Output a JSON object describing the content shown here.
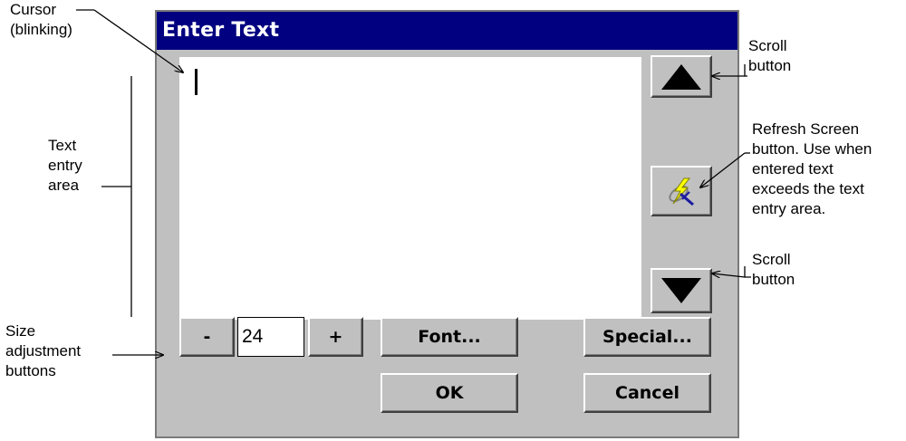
{
  "dialog": {
    "title": "Enter Text",
    "size_value": "24",
    "buttons": {
      "minus": "-",
      "plus": "+",
      "font": "Font...",
      "special": "Special...",
      "ok": "OK",
      "cancel": "Cancel"
    },
    "icons": {
      "scroll_up": "triangle-up-icon",
      "refresh": "refresh-screen-icon",
      "scroll_down": "triangle-down-icon"
    }
  },
  "annotations": {
    "cursor": [
      "Cursor",
      "(blinking)"
    ],
    "text_entry": [
      "Text",
      "entry",
      "area"
    ],
    "size_adjust": [
      "Size",
      "adjustment",
      "buttons"
    ],
    "scroll_top": [
      "Scroll",
      "button"
    ],
    "refresh": [
      "Refresh Screen",
      "button. Use when",
      "entered text",
      "exceeds the text",
      "entry area."
    ],
    "scroll_bottom": [
      "Scroll",
      "button"
    ]
  },
  "colors": {
    "titlebar": "#000080",
    "dialog_face": "#c0c0c0",
    "text_area": "#ffffff"
  }
}
